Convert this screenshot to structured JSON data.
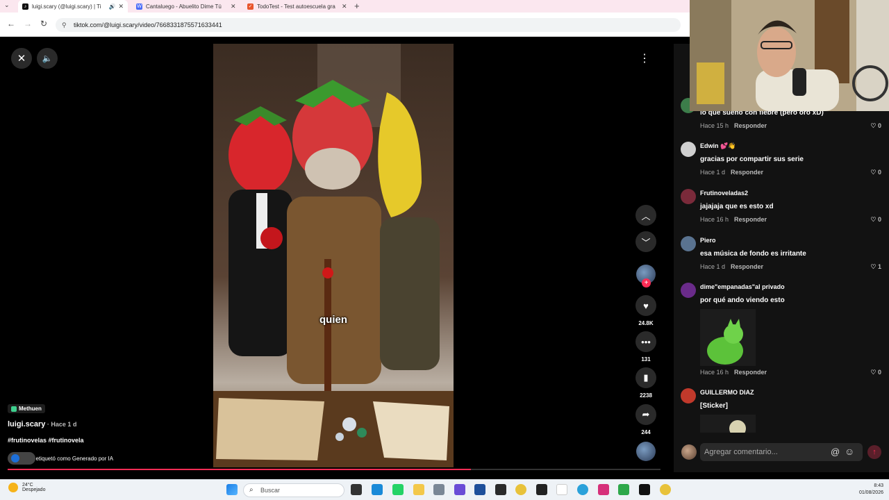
{
  "browser": {
    "tabs": [
      {
        "title": "luigi.scary (@luigi.scary) | Ti",
        "active": true,
        "color": "#111111"
      },
      {
        "title": "Cantaluego - Abuelito Dime Tú",
        "active": false,
        "color": "#4a6cf7"
      },
      {
        "title": "TodoTest - Test autoescuela gra",
        "active": false,
        "color": "#e8552d"
      }
    ],
    "url": "tiktok.com/@luigi.scary/video/7668331875571633441"
  },
  "video": {
    "caption": "quien",
    "music": "Methuen",
    "author": "luigi.scary",
    "posted": " · Hace 1 d",
    "hashtags": "#frutinovelas #frutinovela",
    "ai_label": "lo etiquetó como Generado por IA",
    "progress_percent": 71
  },
  "actions": {
    "likes": "24.8K",
    "comments": "131",
    "saves": "2238",
    "shares": "244"
  },
  "comments": [
    {
      "name": "",
      "text": "lo que sueño con fiebre (pero oro xD)",
      "time": "Hace 15 h",
      "reply": "Responder",
      "likes": "0",
      "color": "#3c7d4a"
    },
    {
      "name": "Edwin 💕👋",
      "text": "gracias por compartir sus serie",
      "time": "Hace 1 d",
      "reply": "Responder",
      "likes": "0",
      "color": "#cfcfcf"
    },
    {
      "name": "Frutinoveladas2",
      "text": "jajajaja que es esto xd",
      "time": "Hace 16 h",
      "reply": "Responder",
      "likes": "0",
      "color": "#7a2a3a"
    },
    {
      "name": "Piero",
      "text": "esa música de fondo es irritante",
      "time": "Hace 1 d",
      "reply": "Responder",
      "likes": "1",
      "color": "#5a7390"
    },
    {
      "name": "dime\"empanadas\"al privado",
      "text": "por qué ando viendo esto",
      "time": "Hace 16 h",
      "reply": "Responder",
      "likes": "0",
      "color": "#6a2b8a"
    },
    {
      "name": "GUILLERMO DIAZ",
      "text": "[Sticker]",
      "time": "",
      "reply": "",
      "likes": "",
      "color": "#c0392b"
    }
  ],
  "comment_input": {
    "placeholder": "Agregar comentario..."
  },
  "taskbar": {
    "temp": "24°C",
    "condition": "Despejado",
    "search": "Buscar",
    "time": "8:43",
    "date": "01/08/2026"
  }
}
